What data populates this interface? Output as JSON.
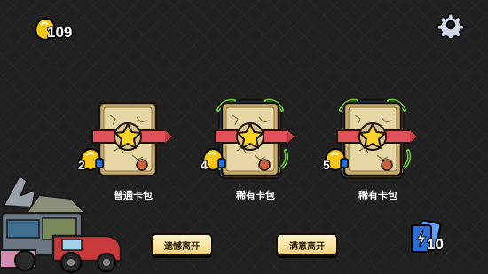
{
  "header": {
    "coin_count": "109",
    "coin_icon": "gold-coin-icon",
    "settings_icon": "gear-icon"
  },
  "packs": [
    {
      "label": "普通卡包",
      "price": "2",
      "tier": "common"
    },
    {
      "label": "稀有卡包",
      "price": "4",
      "tier": "rare"
    },
    {
      "label": "稀有卡包",
      "price": "5",
      "tier": "rare"
    }
  ],
  "buttons": {
    "leave_with_regret": "遗憾离开",
    "leave_satisfied": "满意离开"
  },
  "deck": {
    "count": "10",
    "icon": "lightning-cards-icon"
  },
  "colors": {
    "background": "#212121",
    "gold": "#f5c518",
    "card_parchment": "#d9c48f",
    "ribbon_red": "#e0515a",
    "button_fill": "#f6e3a4",
    "deck_blue": "#2a6fd6"
  }
}
